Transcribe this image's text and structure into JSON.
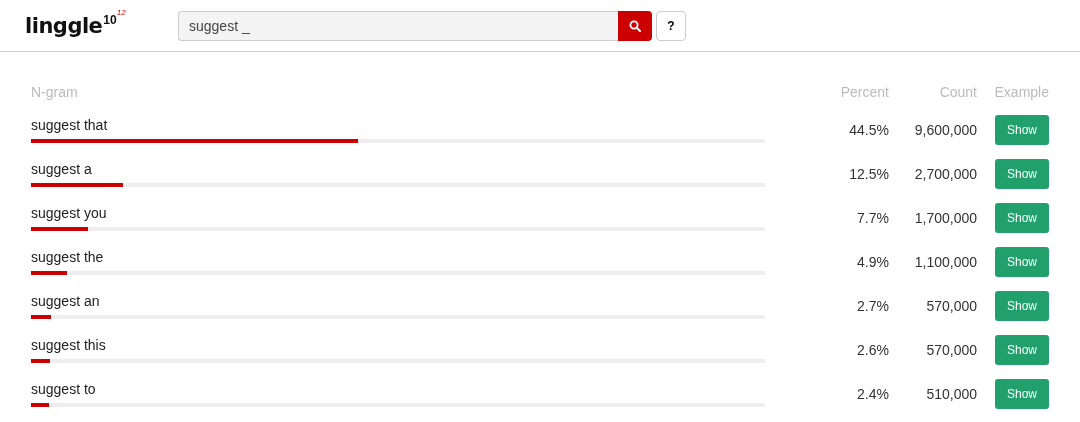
{
  "logo": {
    "name": "linggle",
    "sup": "10",
    "sup2": "12"
  },
  "search": {
    "value": "suggest _",
    "help": "?"
  },
  "table": {
    "columns": [
      "N-gram",
      "Percent",
      "Count",
      "Example"
    ],
    "rows": [
      {
        "ngram": "suggest that",
        "percent": "44.5%",
        "count": "9,600,000",
        "level": 0.445,
        "button": "Show"
      },
      {
        "ngram": "suggest a",
        "percent": "12.5%",
        "count": "2,700,000",
        "level": 0.125,
        "button": "Show"
      },
      {
        "ngram": "suggest you",
        "percent": "7.7%",
        "count": "1,700,000",
        "level": 0.077,
        "button": "Show"
      },
      {
        "ngram": "suggest the",
        "percent": "4.9%",
        "count": "1,100,000",
        "level": 0.049,
        "button": "Show"
      },
      {
        "ngram": "suggest an",
        "percent": "2.7%",
        "count": "570,000",
        "level": 0.027,
        "button": "Show"
      },
      {
        "ngram": "suggest this",
        "percent": "2.6%",
        "count": "570,000",
        "level": 0.026,
        "button": "Show"
      },
      {
        "ngram": "suggest to",
        "percent": "2.4%",
        "count": "510,000",
        "level": 0.024,
        "button": "Show"
      }
    ]
  }
}
